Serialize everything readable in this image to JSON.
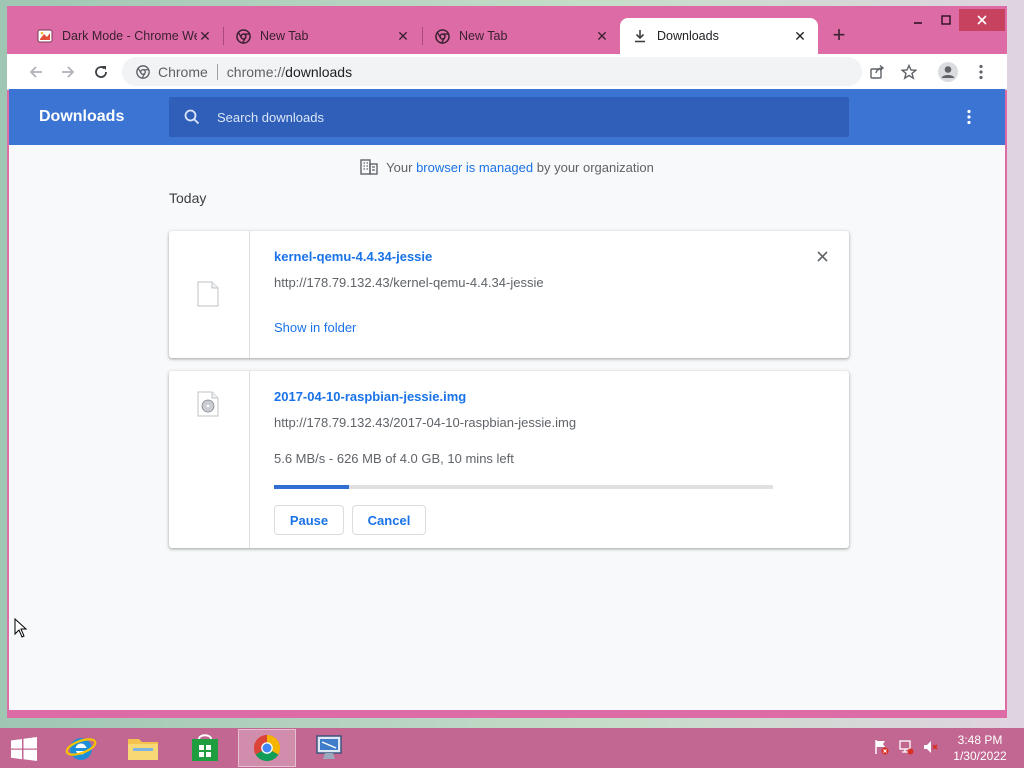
{
  "browser": {
    "tabs": [
      {
        "label": "Dark Mode - Chrome We",
        "icon": "paint-icon"
      },
      {
        "label": "New Tab",
        "icon": "chrome-icon"
      },
      {
        "label": "New Tab",
        "icon": "chrome-icon"
      },
      {
        "label": "Downloads",
        "icon": "download-icon"
      }
    ],
    "omnibox": {
      "chip": "Chrome",
      "url_scheme": "chrome://",
      "url_path": "downloads"
    }
  },
  "downloads": {
    "title": "Downloads",
    "search_placeholder": "Search downloads",
    "managed": {
      "pre": "Your",
      "link": "browser is managed",
      "post": "by your organization"
    },
    "section": "Today",
    "items": [
      {
        "filename": "kernel-qemu-4.4.34-jessie",
        "url": "http://178.79.132.43/kernel-qemu-4.4.34-jessie",
        "action": "Show in folder"
      },
      {
        "filename": "2017-04-10-raspbian-jessie.img",
        "url": "http://178.79.132.43/2017-04-10-raspbian-jessie.img",
        "status": "5.6 MB/s - 626 MB of 4.0 GB, 10 mins left",
        "progress_fraction": 0.15,
        "pause_label": "Pause",
        "cancel_label": "Cancel"
      }
    ]
  },
  "taskbar": {
    "time": "3:48 PM",
    "date": "1/30/2022"
  },
  "colors": {
    "accent": "#3b74d3",
    "link": "#1a73e8",
    "window_frame": "#dd6ca6",
    "taskbar": "#c16791"
  }
}
